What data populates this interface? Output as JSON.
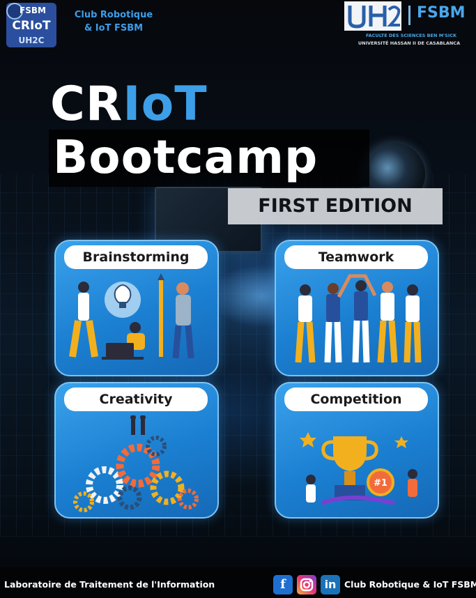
{
  "header": {
    "club_logo_text": [
      "FSBM",
      "CRIoT",
      "UH2C"
    ],
    "club_name_line1": "Club Robotique",
    "club_name_line2": "& IoT FSBM",
    "faculty_short": "FSBM",
    "faculty_name": "FACULTE DES SCIENCES BEN M'SICK",
    "university_name": "UNIVERSITÉ HASSAN II DE CASABLANCA"
  },
  "title": {
    "part_white": "CR",
    "part_blue": "IoT",
    "line2": "Bootcamp",
    "edition": "FIRST EDITION"
  },
  "cards": [
    {
      "label": "Brainstorming",
      "art": "brainstorming-illustration"
    },
    {
      "label": "Teamwork",
      "art": "teamwork-illustration"
    },
    {
      "label": "Creativity",
      "art": "creativity-gears-illustration"
    },
    {
      "label": "Competition",
      "art": "competition-trophy-illustration"
    }
  ],
  "footer": {
    "lab": "Laboratoire de Traitement de l'Information",
    "social_icons": [
      "facebook-icon",
      "instagram-icon",
      "linkedin-icon"
    ],
    "club": "Club Robotique & IoT FSBM"
  },
  "colors": {
    "accent_blue": "#3d9fe8",
    "card_blue": "#1b7fd1",
    "background": "#05070b"
  }
}
